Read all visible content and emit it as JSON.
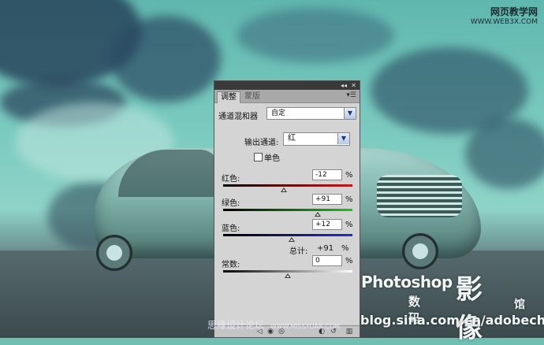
{
  "watermark": {
    "site_cn": "网页教学网",
    "site_url": "WWW.WEB3X.COM",
    "photoshop": "Photoshop",
    "yingxiang": "影像",
    "shuma": "数码",
    "guan": "馆",
    "blog_url": "blog.sina.com.cn/adobech",
    "bottom_cn": "思缘设计论坛",
    "bottom_url": "WWW.MISSYUAN.COM"
  },
  "panel": {
    "tabs": [
      "调整",
      "蒙版"
    ],
    "adjustment_name": "通道混和器",
    "preset_value": "自定",
    "output_channel_label": "输出通道:",
    "output_channel_value": "红",
    "monochrome_label": "单色",
    "monochrome_checked": false,
    "sliders": [
      {
        "label": "红色:",
        "value": "-12",
        "unit": "%",
        "fraction": 0.47
      },
      {
        "label": "绿色:",
        "value": "+91",
        "unit": "%",
        "fraction": 0.73
      },
      {
        "label": "蓝色:",
        "value": "+12",
        "unit": "%",
        "fraction": 0.53
      }
    ],
    "total_label": "总计:",
    "total_value": "+91",
    "total_unit": "%",
    "constant": {
      "label": "常数:",
      "value": "0",
      "unit": "%",
      "fraction": 0.5
    }
  }
}
